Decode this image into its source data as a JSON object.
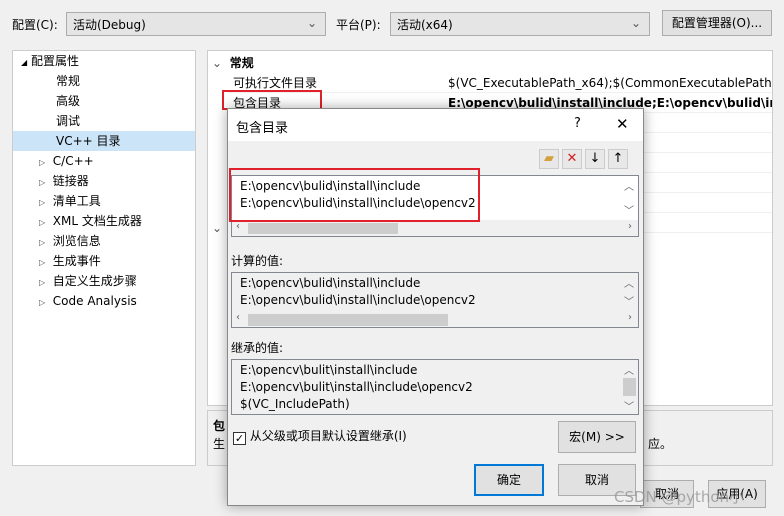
{
  "toolbar": {
    "config_label": "配置(C):",
    "config_value": "活动(Debug)",
    "platform_label": "平台(P):",
    "platform_value": "活动(x64)",
    "config_manager": "配置管理器(O)..."
  },
  "tree": {
    "root": "配置属性",
    "items": [
      "常规",
      "高级",
      "调试",
      "VC++ 目录",
      "C/C++",
      "链接器",
      "清单工具",
      "XML 文档生成器",
      "浏览信息",
      "生成事件",
      "自定义生成步骤",
      "Code Analysis"
    ],
    "selected": "VC++ 目录"
  },
  "grid": {
    "section": "常规",
    "rows": [
      {
        "name": "可执行文件目录",
        "value": "$(VC_ExecutablePath_x64);$(CommonExecutablePath)"
      },
      {
        "name": "包含目录",
        "value": "E:\\opencv\\bulid\\install\\include;E:\\opencv\\bulid\\install\\include\\opencv2"
      },
      {
        "name": "",
        "value": "IncludePath);"
      },
      {
        "name": "",
        "value": ""
      },
      {
        "name": "",
        "value": ";$(LibraryPath)"
      },
      {
        "name": "",
        "value": ""
      },
      {
        "name": "",
        "value": ""
      },
      {
        "name": "",
        "value": "utablePath_x64);$(VC_"
      }
    ]
  },
  "desc": {
    "title": "包",
    "text": "生",
    "text_end": "应。"
  },
  "footer": {
    "cancel": "取消",
    "apply": "应用(A)"
  },
  "dialog": {
    "title": "包含目录",
    "help": "?",
    "close": "✕",
    "tools": [
      {
        "icon": "new-folder-icon"
      },
      {
        "icon": "delete-icon"
      },
      {
        "icon": "move-down-icon"
      },
      {
        "icon": "move-up-icon"
      }
    ],
    "entries": [
      "E:\\opencv\\bulid\\install\\include",
      "E:\\opencv\\bulid\\install\\include\\opencv2"
    ],
    "computed_label": "计算的值:",
    "computed": [
      "E:\\opencv\\bulid\\install\\include",
      "E:\\opencv\\bulid\\install\\include\\opencv2"
    ],
    "inherited_label": "继承的值:",
    "inherited": [
      "E:\\opencv\\bulit\\install\\include",
      "E:\\opencv\\bulit\\install\\include\\opencv2",
      "$(VC_IncludePath)"
    ],
    "inherit_checkbox": "从父级或项目默认设置继承(I)",
    "inherit_checked": true,
    "macro_button": "宏(M) >>",
    "ok": "确定",
    "cancel": "取消"
  },
  "watermark": "CSDN @python小"
}
